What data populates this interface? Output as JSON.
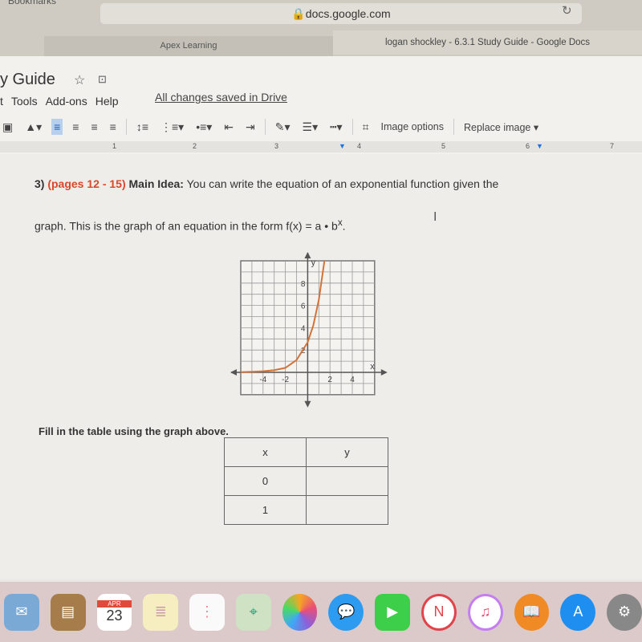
{
  "browser": {
    "bookmarks": "Bookmarks",
    "url": "docs.google.com",
    "tabs": [
      "Apex Learning",
      "logan shockley - 6.3.1 Study Guide - Google Docs"
    ]
  },
  "docs": {
    "title": "y Guide",
    "menu": [
      "t",
      "Tools",
      "Add-ons",
      "Help"
    ],
    "saved": "All changes saved in Drive",
    "toolbar": {
      "image_options": "Image options",
      "replace_image": "Replace image ▾"
    },
    "ruler": [
      "1",
      "2",
      "3",
      "4",
      "5",
      "6",
      "7"
    ]
  },
  "content": {
    "q_num": "3)",
    "q_pages": "(pages 12 - 15)",
    "q_main": "Main Idea:",
    "q_text1": "You can write the equation of an exponential function given the",
    "q_text2": "graph. This is the graph of an equation in the form f(x) = a • b",
    "q_sup": "x",
    "q_end": ".",
    "fill": "Fill in the table using the graph above.",
    "table": {
      "headers": [
        "x",
        "y"
      ],
      "rows": [
        [
          "0",
          ""
        ],
        [
          "1",
          ""
        ]
      ]
    }
  },
  "chart_data": {
    "type": "line",
    "xlabel": "x",
    "ylabel": "y",
    "xlim": [
      -6,
      6
    ],
    "ylim": [
      -2,
      10
    ],
    "grid": true,
    "x_ticks": [
      "-4",
      "-2",
      "2",
      "4"
    ],
    "y_ticks": [
      "2",
      "4",
      "6",
      "8"
    ],
    "curve_color": "#d2733a",
    "points": [
      [
        -6,
        0.02
      ],
      [
        -5,
        0.05
      ],
      [
        -4,
        0.1
      ],
      [
        -3,
        0.2
      ],
      [
        -2,
        0.4
      ],
      [
        -1,
        1.1
      ],
      [
        0,
        2.7
      ],
      [
        0.5,
        4.2
      ],
      [
        1,
        6.5
      ],
      [
        1.5,
        10
      ]
    ]
  },
  "dock": [
    "Mail",
    "Notes",
    "Calendar",
    "Notes",
    "Reminders",
    "Maps",
    "Photos",
    "Messages",
    "FaceTime",
    "News",
    "Music",
    "Books",
    "App Store",
    "System Preferences"
  ],
  "calendar": {
    "month": "APR",
    "day": "23"
  }
}
